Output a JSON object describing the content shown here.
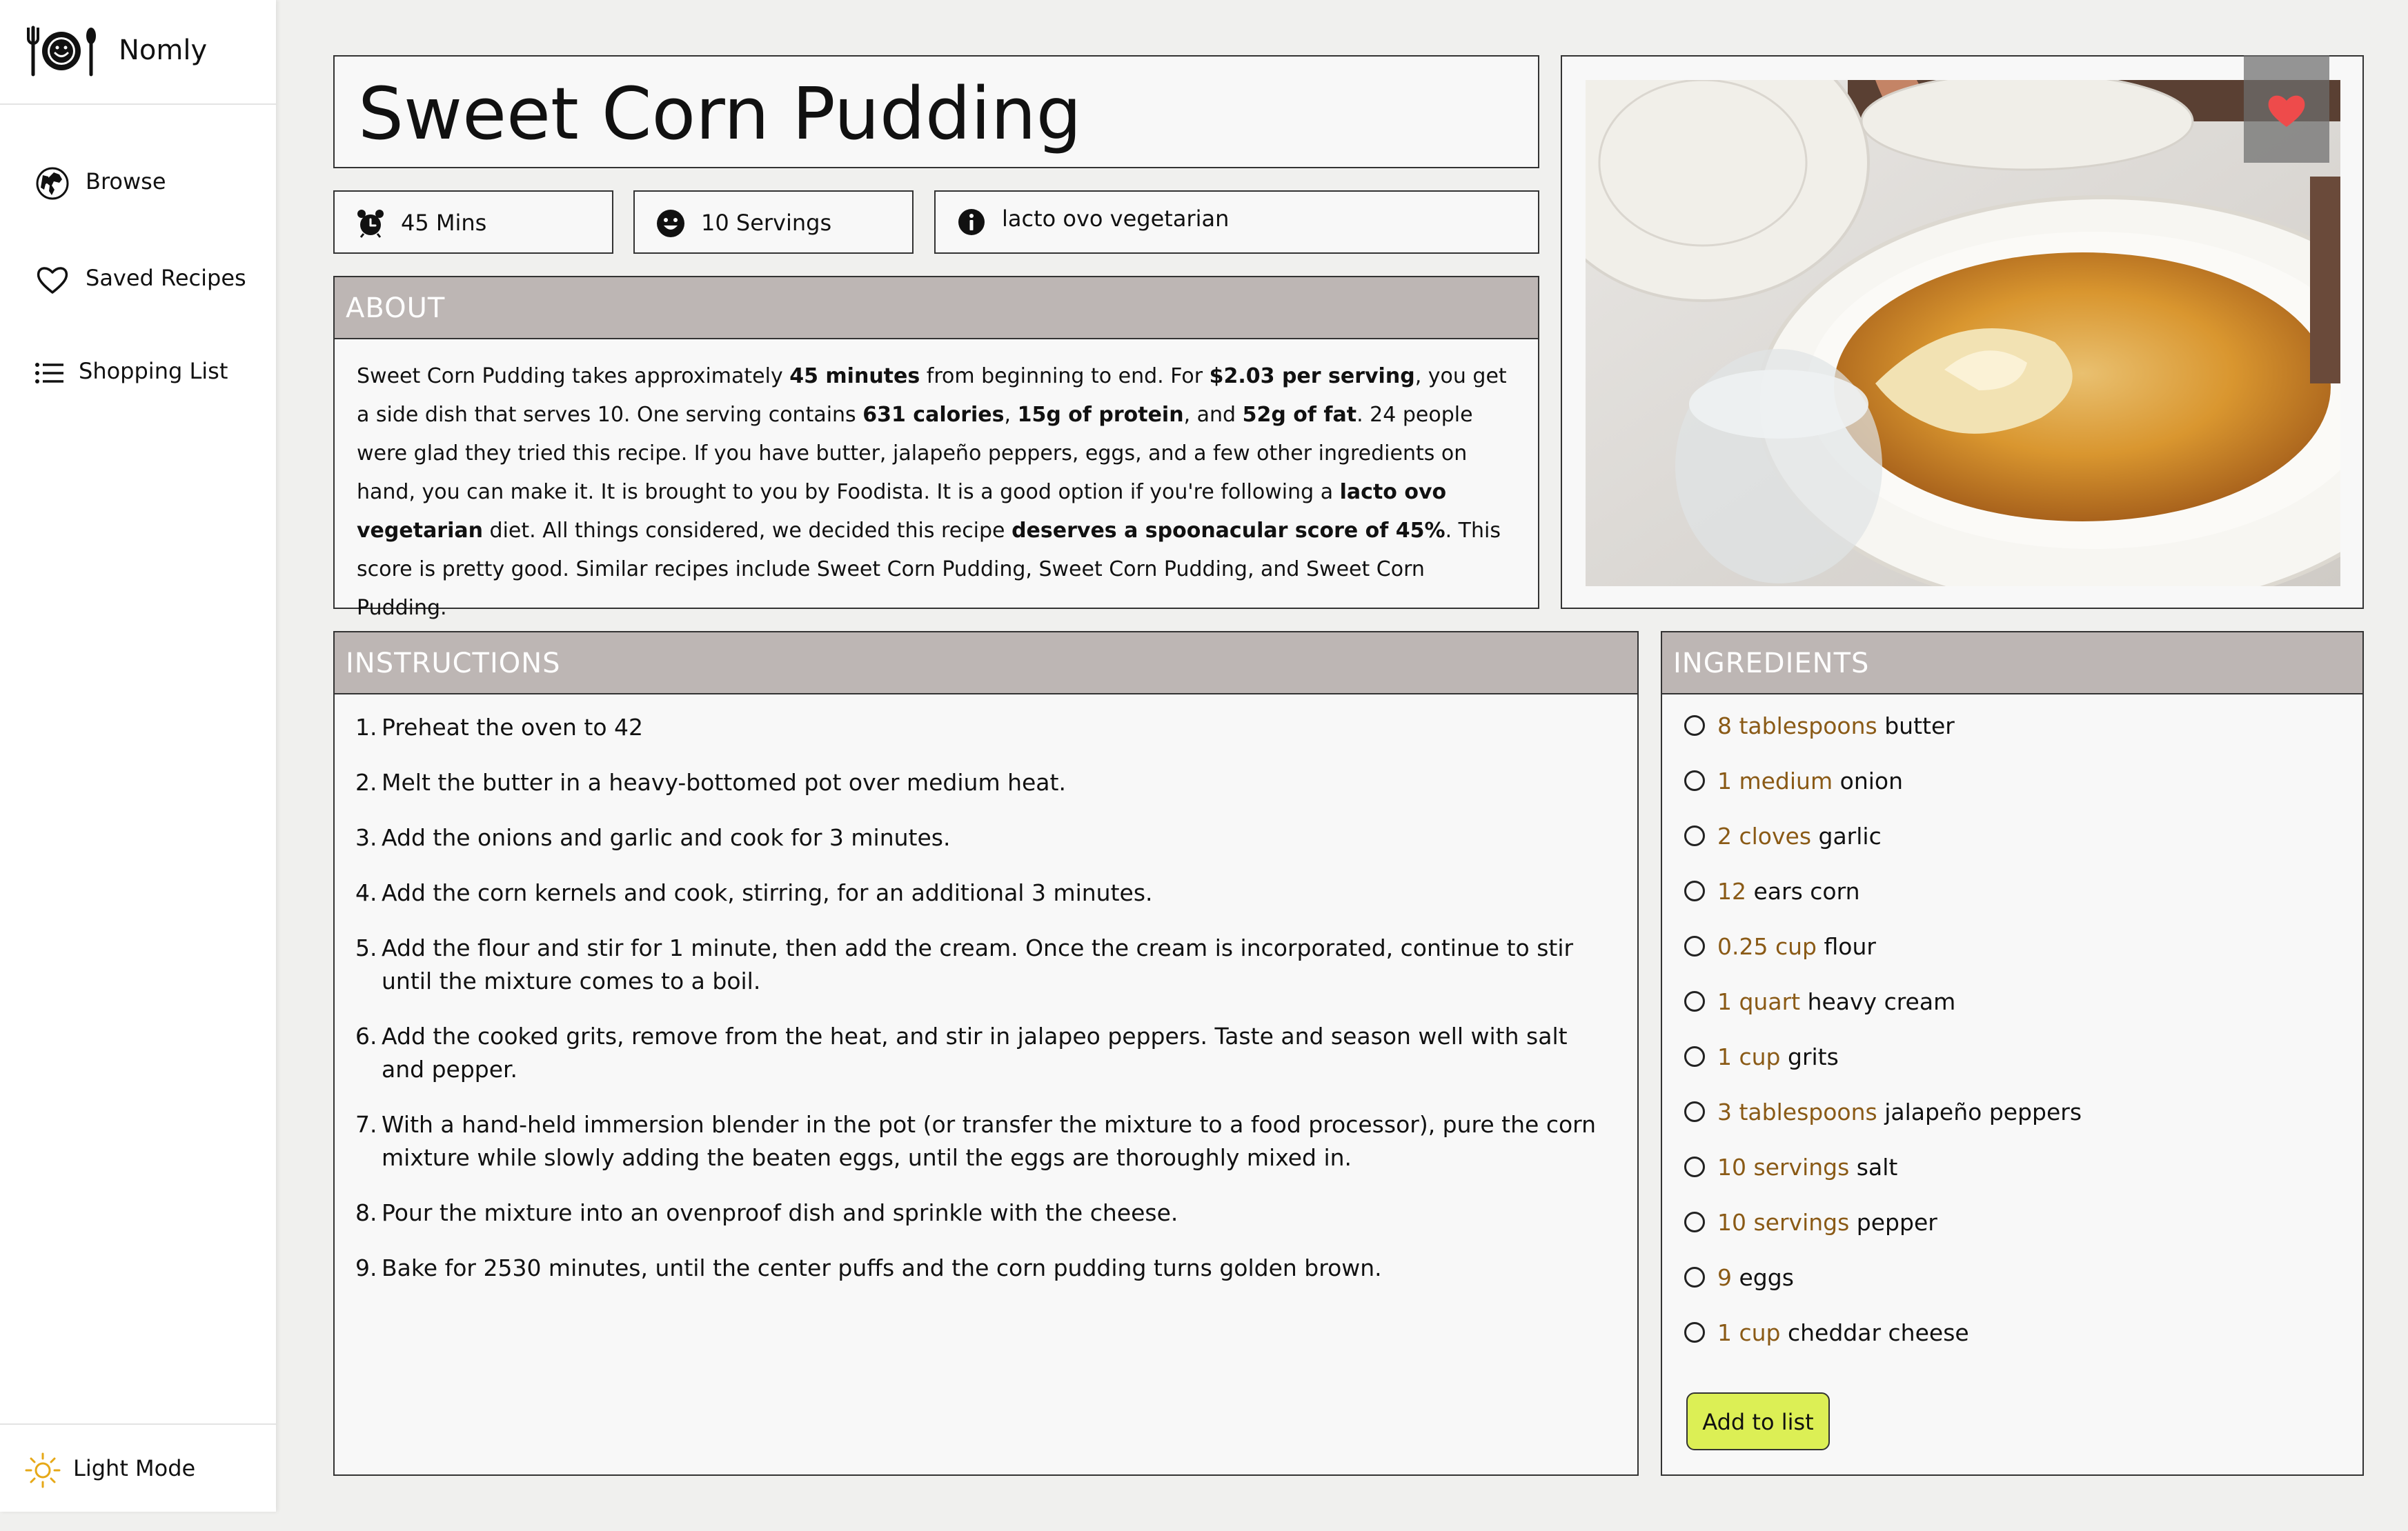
{
  "sidebar": {
    "brand": "Nomly",
    "items": [
      {
        "label": "Browse",
        "icon": "globe-icon"
      },
      {
        "label": "Saved Recipes",
        "icon": "heart-outline-icon"
      },
      {
        "label": "Shopping List",
        "icon": "list-icon"
      }
    ],
    "mode_label": "Light Mode",
    "mode_icon": "sun-icon"
  },
  "recipe": {
    "title": "Sweet Corn Pudding",
    "time": "45 Mins",
    "servings": "10 Servings",
    "diet": "lacto ovo vegetarian",
    "favorite_icon": "heart-filled-icon",
    "favorite_color": "#ee4b4b"
  },
  "about": {
    "header": "ABOUT",
    "segments": [
      {
        "t": "Sweet Corn Pudding takes approximately ",
        "b": false
      },
      {
        "t": "45 minutes",
        "b": true
      },
      {
        "t": " from beginning to end. For ",
        "b": false
      },
      {
        "t": "$2.03 per serving",
        "b": true
      },
      {
        "t": ", you get a side dish that serves 10. One serving contains ",
        "b": false
      },
      {
        "t": "631 calories",
        "b": true
      },
      {
        "t": ", ",
        "b": false
      },
      {
        "t": "15g of protein",
        "b": true
      },
      {
        "t": ", and ",
        "b": false
      },
      {
        "t": "52g of fat",
        "b": true
      },
      {
        "t": ". 24 people were glad they tried this recipe. If you have butter, jalapeño peppers, eggs, and a few other ingredients on hand, you can make it. It is brought to you by Foodista. It is a good option if you're following a ",
        "b": false
      },
      {
        "t": "lacto ovo vegetarian",
        "b": true
      },
      {
        "t": " diet. All things considered, we decided this recipe ",
        "b": false
      },
      {
        "t": "deserves a spoonacular score of 45%",
        "b": true
      },
      {
        "t": ". This score is pretty good. Similar recipes include Sweet Corn Pudding, Sweet Corn Pudding, and Sweet Corn Pudding.",
        "b": false
      }
    ]
  },
  "instructions": {
    "header": "INSTRUCTIONS",
    "steps": [
      "Preheat the oven to 42",
      "Melt the butter in a heavy-bottomed pot over medium heat.",
      "Add the onions and garlic and cook for 3 minutes.",
      "Add the corn kernels and cook, stirring, for an additional 3 minutes.",
      "Add the flour and stir for 1 minute, then add the cream. Once the cream is incorporated, continue to stir until the mixture comes to a boil.",
      "Add the cooked grits, remove from the heat, and stir in jalapeo peppers. Taste and season well with salt and pepper.",
      "With a hand-held immersion blender in the pot (or transfer the mixture to a food processor), pure the corn mixture while slowly adding the beaten eggs, until the eggs are thoroughly mixed in.",
      "Pour the mixture into an ovenproof dish and sprinkle with the cheese.",
      "Bake for 2530 minutes, until the center puffs and the corn pudding turns golden brown."
    ]
  },
  "ingredients": {
    "header": "INGREDIENTS",
    "items": [
      {
        "amount": "8 tablespoons",
        "name": "butter"
      },
      {
        "amount": "1 medium",
        "name": "onion"
      },
      {
        "amount": "2 cloves",
        "name": "garlic"
      },
      {
        "amount": "12",
        "name": "ears corn"
      },
      {
        "amount": "0.25 cup",
        "name": "flour"
      },
      {
        "amount": "1 quart",
        "name": "heavy cream"
      },
      {
        "amount": "1 cup",
        "name": "grits"
      },
      {
        "amount": "3 tablespoons",
        "name": "jalapeño peppers"
      },
      {
        "amount": "10 servings",
        "name": "salt"
      },
      {
        "amount": "10 servings",
        "name": "pepper"
      },
      {
        "amount": "9",
        "name": "eggs"
      },
      {
        "amount": "1 cup",
        "name": "cheddar cheese"
      }
    ],
    "add_button": "Add to list"
  }
}
